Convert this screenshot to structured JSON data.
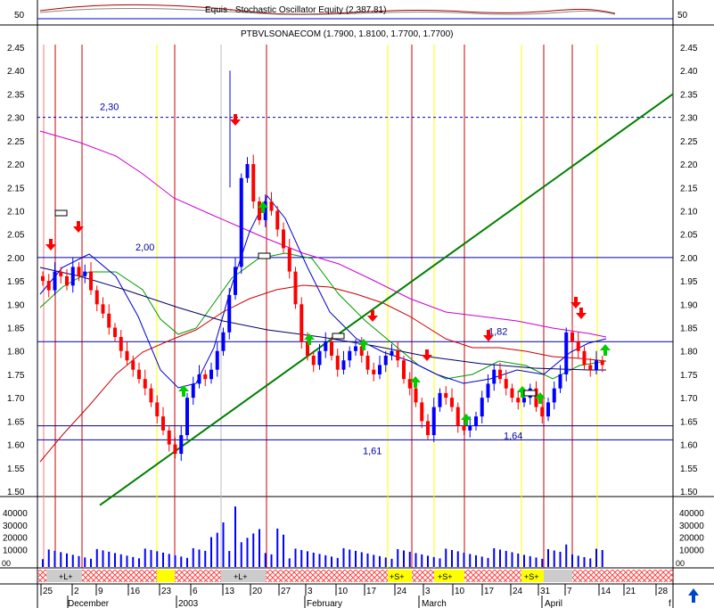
{
  "osc_panel": {
    "label": "Equis - Stochastic Oscillator Equity (2,387.81)",
    "left_tick": "50",
    "right_tick": "50"
  },
  "main_panel": {
    "title": "PTBVLSONAECOM (1.7900, 1.8100, 1.7700, 1.7700)"
  },
  "price_axis": {
    "ticks": [
      {
        "value": 2.45,
        "label": "2.45"
      },
      {
        "value": 2.4,
        "label": "2.40"
      },
      {
        "value": 2.35,
        "label": "2.35"
      },
      {
        "value": 2.3,
        "label": "2.30"
      },
      {
        "value": 2.25,
        "label": "2.25"
      },
      {
        "value": 2.2,
        "label": "2.20"
      },
      {
        "value": 2.15,
        "label": "2.15"
      },
      {
        "value": 2.1,
        "label": "2.10"
      },
      {
        "value": 2.05,
        "label": "2.05"
      },
      {
        "value": 2.0,
        "label": "2.00"
      },
      {
        "value": 1.95,
        "label": "1.95"
      },
      {
        "value": 1.9,
        "label": "1.90"
      },
      {
        "value": 1.85,
        "label": "1.85"
      },
      {
        "value": 1.8,
        "label": "1.80"
      },
      {
        "value": 1.75,
        "label": "1.75"
      },
      {
        "value": 1.7,
        "label": "1.70"
      },
      {
        "value": 1.65,
        "label": "1.65"
      },
      {
        "value": 1.6,
        "label": "1.60"
      },
      {
        "value": 1.55,
        "label": "1.55"
      },
      {
        "value": 1.5,
        "label": "1.50"
      }
    ]
  },
  "volume_axis": {
    "ticks": [
      {
        "value": 40000,
        "label": "40000"
      },
      {
        "value": 30000,
        "label": "30000"
      },
      {
        "value": 20000,
        "label": "20000"
      },
      {
        "value": 10000,
        "label": "10000"
      }
    ],
    "edge_label_left": "00",
    "edge_label_right": "00"
  },
  "level_labels": [
    {
      "text": "2,30",
      "value": 2.3
    },
    {
      "text": "2,00",
      "value": 2.0
    },
    {
      "text": "1,82",
      "value": 1.82
    },
    {
      "text": "1,64",
      "value": 1.64
    },
    {
      "text": "1,61",
      "value": 1.61
    }
  ],
  "date_axis": {
    "day_labels": [
      "25",
      "2",
      "9",
      "16",
      "23",
      "6",
      "13",
      "20",
      "27",
      "3",
      "10",
      "17",
      "24",
      "3",
      "10",
      "17",
      "24",
      "31",
      "7",
      "14",
      "21",
      "28"
    ],
    "month_labels": [
      {
        "text": "December"
      },
      {
        "text": "2003"
      },
      {
        "text": "February"
      },
      {
        "text": "March"
      },
      {
        "text": "April"
      }
    ],
    "end_mark": "f",
    "scroll_arrow": "up-arrow-icon"
  },
  "signal_bar": {
    "tags": [
      "+L+",
      "+L+",
      "+S+",
      "+S+",
      "+S+"
    ]
  },
  "chart_data": {
    "type": "candlestick",
    "title": "PTBVLSONAECOM (1.7900, 1.8100, 1.7700, 1.7700)",
    "ylim": [
      1.5,
      2.45
    ],
    "x_range": [
      "2002-11-25",
      "2003-04-28"
    ],
    "last_close": {
      "open": 1.79,
      "high": 1.81,
      "low": 1.77,
      "close": 1.77
    },
    "ohlc_samples": [
      {
        "date": "2002-11-25",
        "close": 1.95
      },
      {
        "date": "2002-12-02",
        "close": 1.96
      },
      {
        "date": "2002-12-09",
        "close": 1.89
      },
      {
        "date": "2002-12-16",
        "close": 1.8
      },
      {
        "date": "2002-12-23",
        "close": 1.72
      },
      {
        "date": "2003-01-02",
        "close": 1.6
      },
      {
        "date": "2003-01-06",
        "close": 1.73
      },
      {
        "date": "2003-01-13",
        "close": 1.92
      },
      {
        "date": "2003-01-16",
        "close": 2.2
      },
      {
        "date": "2003-01-20",
        "close": 2.1
      },
      {
        "date": "2003-01-27",
        "close": 1.95
      },
      {
        "date": "2003-02-03",
        "close": 1.77
      },
      {
        "date": "2003-02-10",
        "close": 1.8
      },
      {
        "date": "2003-02-17",
        "close": 1.79
      },
      {
        "date": "2003-02-24",
        "close": 1.71
      },
      {
        "date": "2003-03-03",
        "close": 1.66
      },
      {
        "date": "2003-03-10",
        "close": 1.64
      },
      {
        "date": "2003-03-17",
        "close": 1.75
      },
      {
        "date": "2003-03-24",
        "close": 1.71
      },
      {
        "date": "2003-03-31",
        "close": 1.68
      },
      {
        "date": "2003-04-07",
        "close": 1.85
      },
      {
        "date": "2003-04-14",
        "close": 1.77
      }
    ],
    "horizontal_levels": [
      2.3,
      2.0,
      1.82,
      1.64,
      1.61
    ],
    "trendline": {
      "from": {
        "date": "2002-12-09",
        "value": 1.47
      },
      "to": {
        "date": "2003-04-28",
        "value": 2.35
      }
    },
    "volume_spike": {
      "date": "2003-01-16",
      "value": 45000
    },
    "colors": {
      "up": "#0000ff",
      "down": "#ff0000",
      "buy_arrow": "#00cc00",
      "sell_arrow": "#ff0000",
      "trendline": "#008000",
      "ma_long": "#cc00cc",
      "ma_mid": "#cc0000"
    }
  }
}
